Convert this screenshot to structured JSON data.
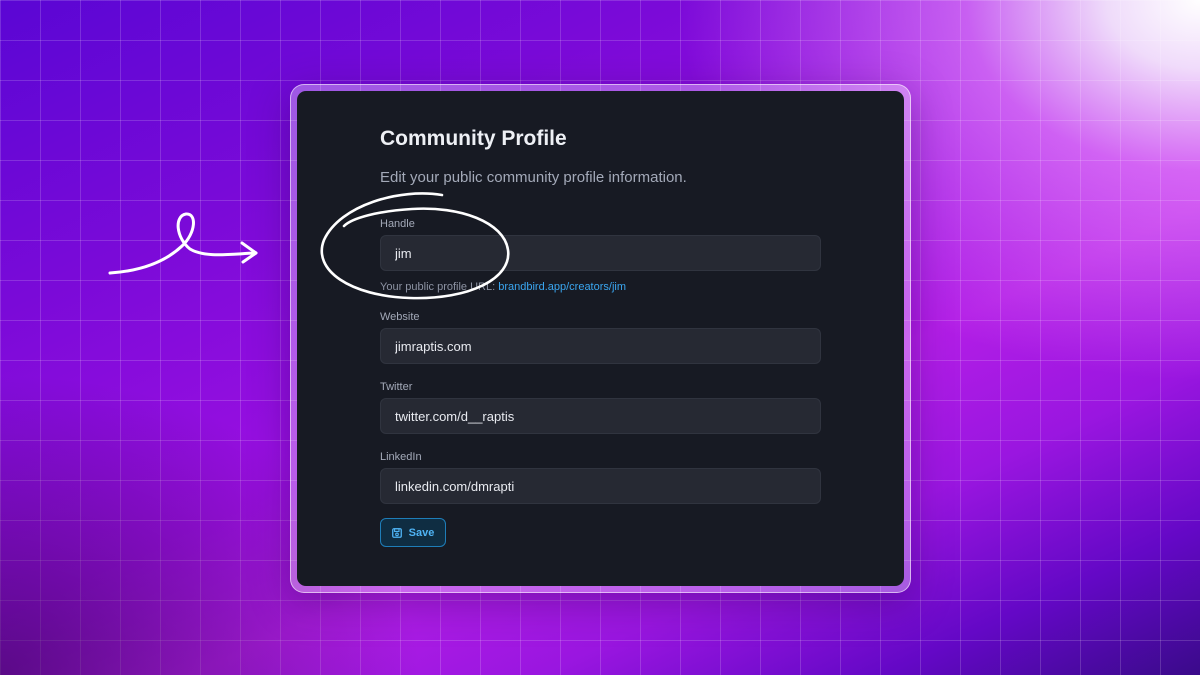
{
  "page": {
    "title": "Community Profile",
    "subtitle": "Edit your public community profile information."
  },
  "form": {
    "handle": {
      "label": "Handle",
      "value": "jim",
      "help_prefix": "Your public profile URL: ",
      "help_link": "brandbird.app/creators/jim"
    },
    "website": {
      "label": "Website",
      "value": "jimraptis.com"
    },
    "twitter": {
      "label": "Twitter",
      "value": "twitter.com/d__raptis"
    },
    "linkedin": {
      "label": "LinkedIn",
      "value": "linkedin.com/dmrapti"
    },
    "save_label": "Save"
  },
  "icons": {
    "save": "floppy-disk-icon",
    "annotation_arrow": "hand-drawn-arrow",
    "annotation_circle": "hand-drawn-circle"
  },
  "colors": {
    "card_background": "#171a23",
    "input_background": "#262933",
    "accent": "#3aa6f0",
    "annotation": "#ffffff"
  }
}
